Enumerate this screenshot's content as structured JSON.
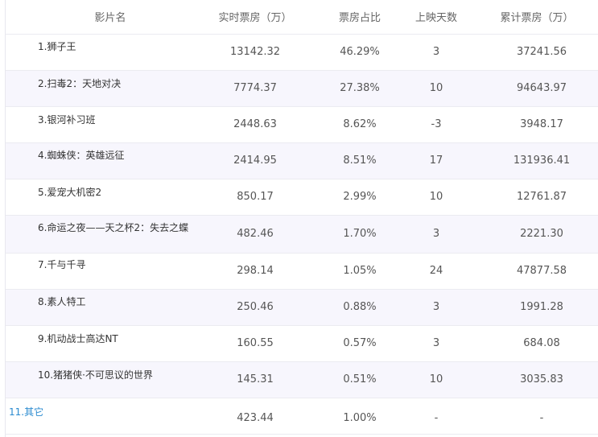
{
  "table": {
    "headers": [
      "影片名",
      "实时票房（万）",
      "票房占比",
      "上映天数",
      "累计票房（万）"
    ],
    "rows": [
      {
        "name": "1.狮子王",
        "realtime": "13142.32",
        "share": "46.29%",
        "days": "3",
        "total": "37241.56"
      },
      {
        "name": "2.扫毒2：天地对决",
        "realtime": "7774.37",
        "share": "27.38%",
        "days": "10",
        "total": "94643.97"
      },
      {
        "name": "3.银河补习班",
        "realtime": "2448.63",
        "share": "8.62%",
        "days": "-3",
        "total": "3948.17"
      },
      {
        "name": "4.蜘蛛侠：英雄远征",
        "realtime": "2414.95",
        "share": "8.51%",
        "days": "17",
        "total": "131936.41"
      },
      {
        "name": "5.爱宠大机密2",
        "realtime": "850.17",
        "share": "2.99%",
        "days": "10",
        "total": "12761.87"
      },
      {
        "name": "6.命运之夜——天之杯2：失去之蝶",
        "realtime": "482.46",
        "share": "1.70%",
        "days": "3",
        "total": "2221.30"
      },
      {
        "name": "7.千与千寻",
        "realtime": "298.14",
        "share": "1.05%",
        "days": "24",
        "total": "47877.58"
      },
      {
        "name": "8.素人特工",
        "realtime": "250.46",
        "share": "0.88%",
        "days": "3",
        "total": "1991.28"
      },
      {
        "name": "9.机动战士高达NT",
        "realtime": "160.55",
        "share": "0.57%",
        "days": "3",
        "total": "684.08"
      },
      {
        "name": "10.猪猪侠·不可思议的世界",
        "realtime": "145.31",
        "share": "0.51%",
        "days": "10",
        "total": "3035.83"
      },
      {
        "name": "11.其它",
        "realtime": "423.44",
        "share": "1.00%",
        "days": "-",
        "total": "-"
      }
    ]
  },
  "colors": {
    "link": "#2b8bd0",
    "alt_row": "#f7f6fd",
    "border": "#ebebf1"
  }
}
